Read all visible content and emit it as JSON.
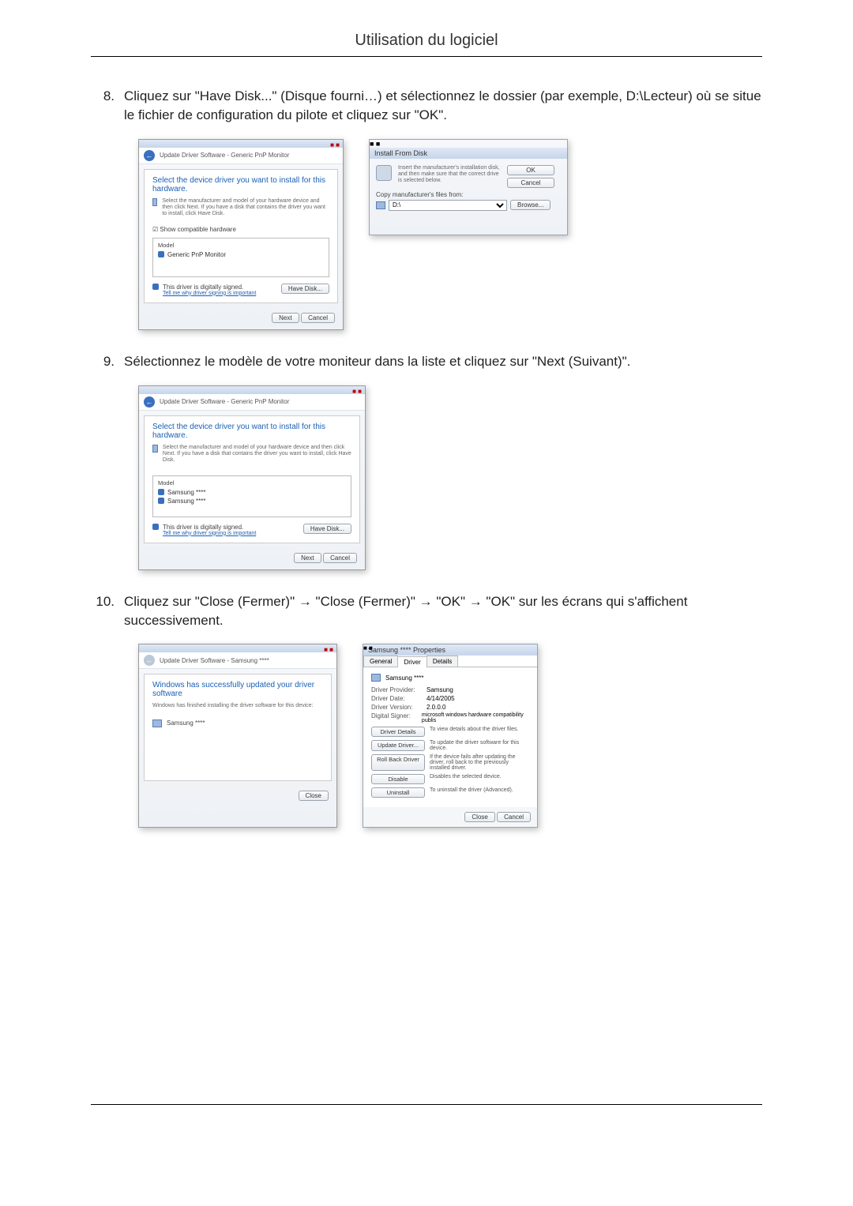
{
  "page": {
    "title": "Utilisation du logiciel"
  },
  "step8": {
    "num": "8.",
    "text": "Cliquez sur \"Have Disk...\" (Disque fourni…) et sélectionnez le dossier (par exemple, D:\\Lecteur) où se situe le fichier de configuration du pilote et cliquez sur \"OK\"."
  },
  "step9": {
    "num": "9.",
    "text": "Sélectionnez le modèle de votre moniteur dans la liste et cliquez sur \"Next (Suivant)\"."
  },
  "step10": {
    "num": "10.",
    "text": "Cliquez sur \"Close (Fermer)\" → \"Close (Fermer)\" → \"OK\" → \"OK\" sur les écrans qui s'affichent successivement."
  },
  "dlgDriver1": {
    "nav": "Update Driver Software - Generic PnP Monitor",
    "heading": "Select the device driver you want to install for this hardware.",
    "desc": "Select the manufacturer and model of your hardware device and then click Next. If you have a disk that contains the driver you want to install, click Have Disk.",
    "showCompat": "Show compatible hardware",
    "modelHdr": "Model",
    "modelRow": "Generic PnP Monitor",
    "signed": "This driver is digitally signed.",
    "whyLink": "Tell me why driver signing is important",
    "haveDisk": "Have Disk...",
    "next": "Next",
    "cancel": "Cancel"
  },
  "dlgDisk": {
    "title": "Install From Disk",
    "msg": "Insert the manufacturer's installation disk, and then make sure that the correct drive is selected below.",
    "ok": "OK",
    "cancel": "Cancel",
    "copyLabel": "Copy manufacturer's files from:",
    "drive": "D:\\",
    "browse": "Browse..."
  },
  "dlgDriver2": {
    "nav": "Update Driver Software - Generic PnP Monitor",
    "heading": "Select the device driver you want to install for this hardware.",
    "desc": "Select the manufacturer and model of your hardware device and then click Next. If you have a disk that contains the driver you want to install, click Have Disk.",
    "modelHdr": "Model",
    "row1": "Samsung ****",
    "row2": "Samsung ****",
    "signed": "This driver is digitally signed.",
    "whyLink": "Tell me why driver signing is important",
    "haveDisk": "Have Disk...",
    "next": "Next",
    "cancel": "Cancel"
  },
  "dlgSuccess": {
    "nav": "Update Driver Software - Samsung ****",
    "heading": "Windows has successfully updated your driver software",
    "sub": "Windows has finished installing the driver software for this device:",
    "device": "Samsung ****",
    "close": "Close"
  },
  "dlgProps": {
    "title": "Samsung **** Properties",
    "tabGeneral": "General",
    "tabDriver": "Driver",
    "tabDetails": "Details",
    "device": "Samsung ****",
    "provider_k": "Driver Provider:",
    "provider_v": "Samsung",
    "date_k": "Driver Date:",
    "date_v": "4/14/2005",
    "ver_k": "Driver Version:",
    "ver_v": "2.0.0.0",
    "signer_k": "Digital Signer:",
    "signer_v": "microsoft windows hardware compatibility publis",
    "btn_details": "Driver Details",
    "btn_details_d": "To view details about the driver files.",
    "btn_update": "Update Driver...",
    "btn_update_d": "To update the driver software for this device.",
    "btn_roll": "Roll Back Driver",
    "btn_roll_d": "If the device fails after updating the driver, roll back to the previously installed driver.",
    "btn_disable": "Disable",
    "btn_disable_d": "Disables the selected device.",
    "btn_uninstall": "Uninstall",
    "btn_uninstall_d": "To uninstall the driver (Advanced).",
    "close": "Close",
    "cancel": "Cancel"
  }
}
